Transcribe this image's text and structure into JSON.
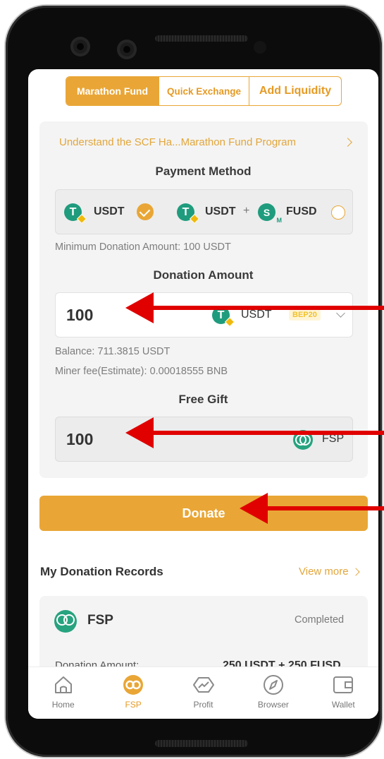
{
  "tabs": [
    {
      "label": "Marathon Fund",
      "active": true
    },
    {
      "label": "Quick Exchange",
      "active": false
    },
    {
      "label": "Add Liquidity",
      "active": false
    }
  ],
  "program_link": "Understand the SCF Ha...Marathon Fund Program",
  "payment": {
    "title": "Payment Method",
    "option1": {
      "token": "USDT",
      "selected": true
    },
    "option2": {
      "token_a": "USDT",
      "plus": "+",
      "token_b": "FUSD",
      "selected": false
    },
    "min_note": "Minimum Donation Amount: 100 USDT"
  },
  "donation": {
    "title": "Donation Amount",
    "amount": "100",
    "token": "USDT",
    "network": "BEP20",
    "balance": "Balance: 711.3815 USDT",
    "miner_fee": "Miner fee(Estimate): 0.00018555 BNB"
  },
  "gift": {
    "title": "Free Gift",
    "amount": "100",
    "token": "FSP"
  },
  "donate_button": "Donate",
  "records": {
    "title": "My Donation Records",
    "view_more": "View more",
    "item": {
      "name": "FSP",
      "status": "Completed",
      "label": "Donation Amount:",
      "value": "250 USDT + 250 FUSD"
    }
  },
  "nav": [
    {
      "label": "Home",
      "icon": "home-icon",
      "active": false
    },
    {
      "label": "FSP",
      "icon": "fsp-icon",
      "active": true
    },
    {
      "label": "Profit",
      "icon": "profit-icon",
      "active": false
    },
    {
      "label": "Browser",
      "icon": "compass-icon",
      "active": false
    },
    {
      "label": "Wallet",
      "icon": "wallet-icon",
      "active": false
    }
  ],
  "colors": {
    "accent": "#e9a636",
    "token_green": "#1f9c7d",
    "annotation_arrow": "#e00000"
  }
}
